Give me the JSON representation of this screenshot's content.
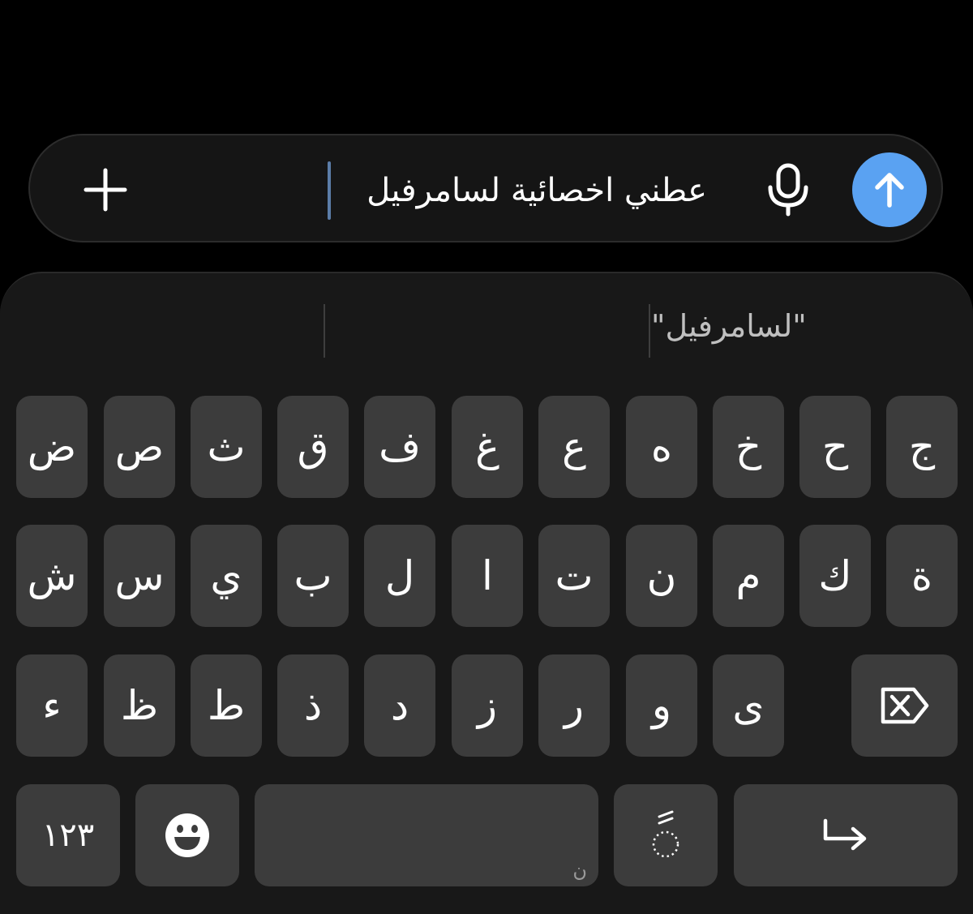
{
  "input": {
    "text": "عطني اخصائية لسامرفيل",
    "plus_icon": "plus-icon",
    "mic_icon": "microphone-icon",
    "send_icon": "arrow-up-icon",
    "send_color": "#5aa2f2"
  },
  "suggestions": [
    "\"لسامرفيل\"",
    "",
    ""
  ],
  "keyboard": {
    "row1": [
      "ج",
      "ح",
      "خ",
      "ه",
      "ع",
      "غ",
      "ف",
      "ق",
      "ث",
      "ص",
      "ض"
    ],
    "row2": [
      "ة",
      "ك",
      "م",
      "ن",
      "ت",
      "ا",
      "ل",
      "ب",
      "ي",
      "س",
      "ش"
    ],
    "row3": [
      "ى",
      "و",
      "ر",
      "ز",
      "د",
      "ذ",
      "ط",
      "ظ",
      "ء"
    ],
    "numbers_label": "١٢٣",
    "space_hint": "ن",
    "diacritic_label": "ًٌُ",
    "backspace_icon": "backspace-icon",
    "emoji_icon": "emoji-icon",
    "enter_icon": "return-arrow-icon"
  }
}
